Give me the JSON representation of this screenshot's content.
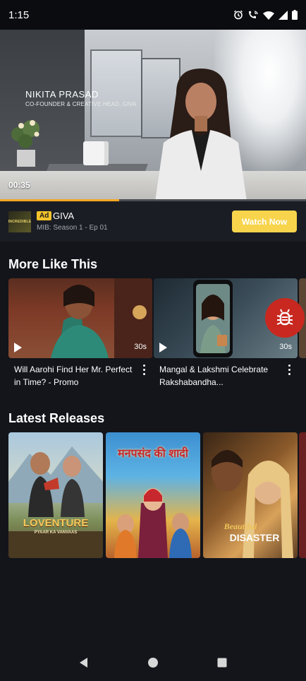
{
  "status_bar": {
    "time": "1:15",
    "icons": [
      "alarm-icon",
      "wifi-calling-icon",
      "wifi-icon",
      "signal-icon",
      "battery-icon"
    ]
  },
  "player": {
    "overlay_name": "NIKITA PRASAD",
    "overlay_role": "CO-FOUNDER & CREATIVE HEAD, GIVA",
    "timecode": "00:35",
    "progress_fraction": 0.39,
    "progress_color": "#f5a623"
  },
  "ad_bar": {
    "thumb_text": "INCREDIBLE",
    "badge": "Ad",
    "brand": "GIVA",
    "subtitle": "MIB: Season 1 - Ep 01",
    "cta_label": "Watch Now",
    "cta_color": "#f7d44c"
  },
  "more_like_this": {
    "title": "More Like This",
    "items": [
      {
        "title": "Will Aarohi Find Her Mr. Perfect in Time? - Promo",
        "duration": "30s"
      },
      {
        "title": "Mangal & Lakshmi Celebrate Rakshabandha...",
        "duration": "30s"
      }
    ]
  },
  "latest_releases": {
    "title": "Latest Releases",
    "posters": [
      {
        "title": "LOVENTURE",
        "subtitle": "PYAAR KA VANVAAS"
      },
      {
        "title": "मनपसंद की शादी"
      },
      {
        "title": "Beautiful",
        "subtitle": "DISASTER"
      }
    ]
  },
  "nav_bar": {
    "icons": [
      "back-icon",
      "home-icon",
      "recents-icon"
    ]
  }
}
